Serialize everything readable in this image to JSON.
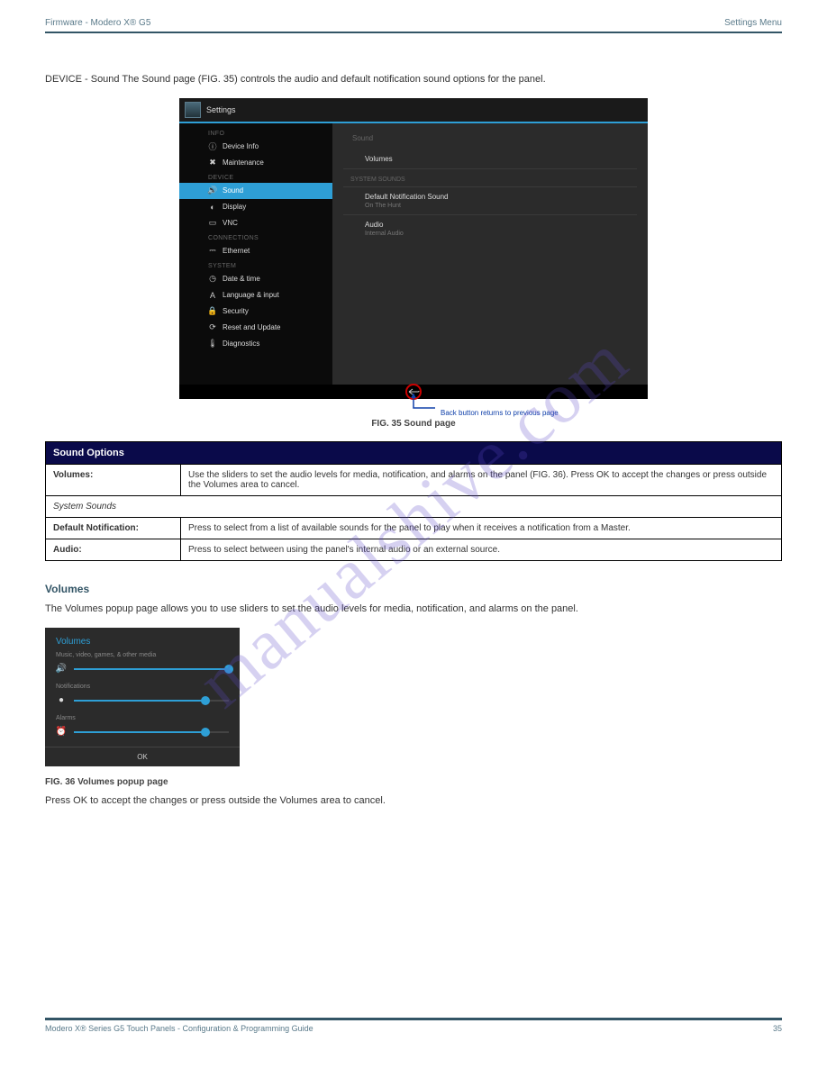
{
  "header": {
    "left": "Firmware - Modero X® G5",
    "right": "Settings Menu"
  },
  "intro": "DEVICE - Sound  The Sound page (FIG. 35) controls the audio and default notification sound options for the panel.",
  "screenshot1": {
    "title": "Settings",
    "categories": {
      "info": "INFO",
      "device": "DEVICE",
      "connections": "CONNECTIONS",
      "system": "SYSTEM"
    },
    "items": {
      "deviceinfo": "Device Info",
      "maintenance": "Maintenance",
      "sound": "Sound",
      "display": "Display",
      "vnc": "VNC",
      "ethernet": "Ethernet",
      "datetime": "Date & time",
      "language": "Language & input",
      "security": "Security",
      "reset": "Reset and Update",
      "diagnostics": "Diagnostics"
    },
    "content": {
      "title": "Sound",
      "volumes": "Volumes",
      "system_sounds": "SYSTEM SOUNDS",
      "default_notification": "Default Notification Sound",
      "default_notification_sub": "On The Hunt",
      "audio": "Audio",
      "audio_sub": "Internal Audio"
    },
    "back_annotation": "Back button returns to previous page"
  },
  "fig1_caption": "FIG. 35  Sound page",
  "table": {
    "header": "Sound Options",
    "rows": [
      {
        "label": "",
        "value": "Use the sliders to set the audio levels for media, notification, and alarms on the panel (FIG. 36). Press OK to accept the changes or press outside the Volumes area to cancel.",
        "colspan_label": "Volumes:"
      },
      {
        "sub": "System Sounds"
      },
      {
        "label": "",
        "value": "Press to select from a list of available sounds for the panel to play when it receives a notification from a Master.",
        "colspan_label": "Default Notification:"
      },
      {
        "label": "",
        "value": "Press to select between using the panel's internal audio or an external source.",
        "colspan_label": "Audio:"
      }
    ]
  },
  "volumes_heading": "Volumes",
  "volumes_copy": "The Volumes popup page allows you to use sliders to set the audio levels for media, notification, and alarms on the panel.",
  "screenshot2": {
    "title": "Volumes",
    "media_label": "Music, video, games, & other media",
    "notifications_label": "Notifications",
    "alarms_label": "Alarms",
    "ok": "OK",
    "media_pct": 100,
    "notifications_pct": 85,
    "alarms_pct": 85
  },
  "fig2_caption": "FIG. 36  Volumes popup page",
  "volumes_after": "Press OK to accept the changes or press outside the Volumes area to cancel.",
  "watermark": "manualshive.com",
  "footer": {
    "left": "Modero X® Series G5 Touch Panels - Configuration & Programming Guide",
    "right": "35"
  }
}
